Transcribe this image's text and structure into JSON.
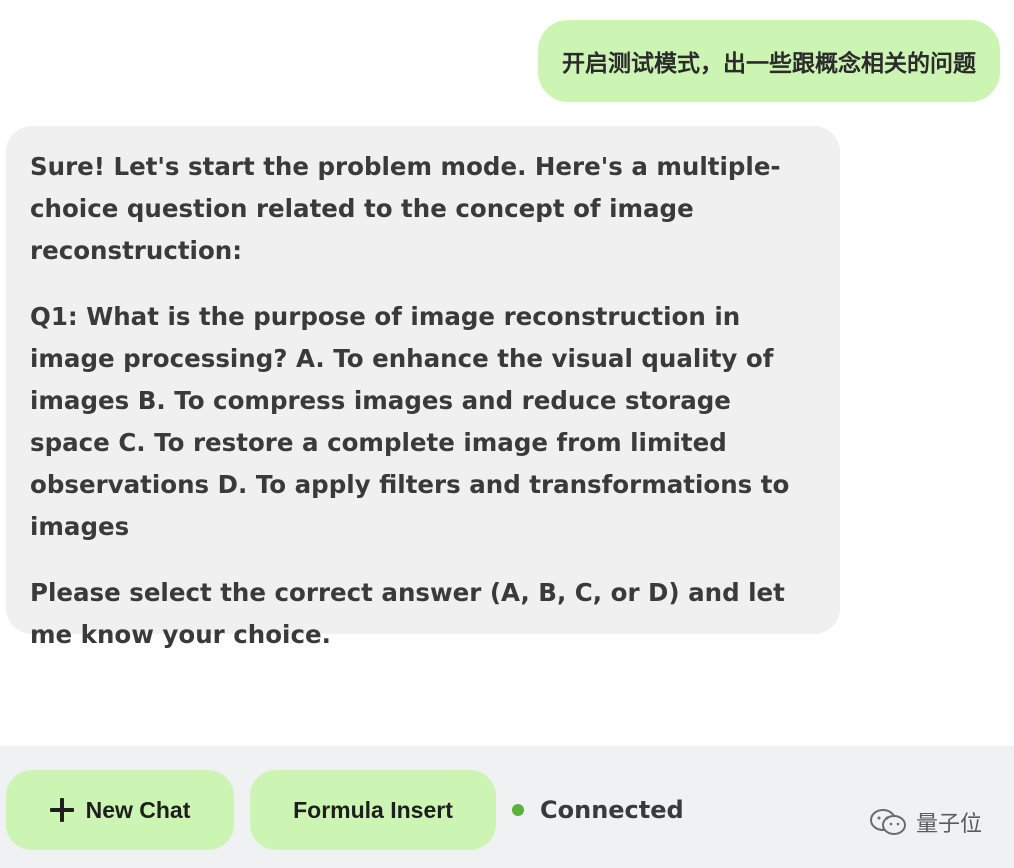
{
  "chat": {
    "user_message": "开启测试模式，出一些跟概念相关的问题",
    "assistant_message": {
      "intro": "Sure! Let's start the problem mode. Here's a multiple-choice question related to the concept of image reconstruction:",
      "question": "Q1: What is the purpose of image reconstruction in image processing? A. To enhance the visual quality of images B. To compress images and reduce storage space C. To restore a complete image from limited observations D. To apply filters and transformations to images",
      "prompt": "Please select the correct answer (A, B, C, or D) and let me know your choice."
    }
  },
  "toolbar": {
    "new_chat_label": "New Chat",
    "formula_insert_label": "Formula Insert",
    "status_text": "Connected"
  },
  "watermark": {
    "text": "量子位",
    "icon": "wechat-icon"
  },
  "colors": {
    "accent_green": "#ccf5b3",
    "bubble_gray": "#f0f0f0",
    "status_green": "#57b33c",
    "bottom_bar": "#f0f1f3"
  },
  "icons": {
    "new_chat": "plus-icon",
    "status": "status-dot-icon"
  }
}
